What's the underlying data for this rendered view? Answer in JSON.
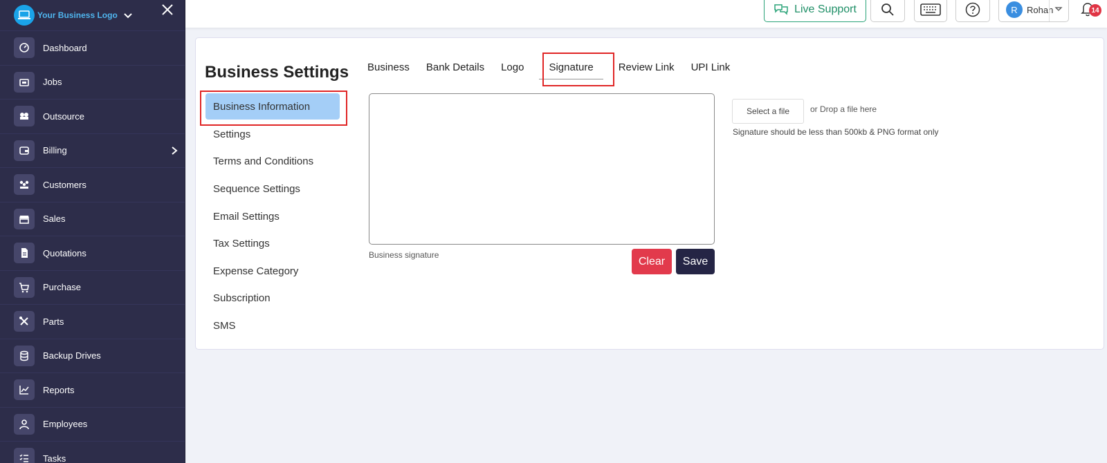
{
  "brand": {
    "name": "Your Business Logo"
  },
  "sidebar": {
    "items": [
      {
        "label": "Dashboard",
        "icon": "dashboard-icon"
      },
      {
        "label": "Jobs",
        "icon": "jobs-icon"
      },
      {
        "label": "Outsource",
        "icon": "outsource-icon"
      },
      {
        "label": "Billing",
        "icon": "wallet-icon"
      },
      {
        "label": "Customers",
        "icon": "users-icon"
      },
      {
        "label": "Sales",
        "icon": "store-icon"
      },
      {
        "label": "Quotations",
        "icon": "document-icon"
      },
      {
        "label": "Purchase",
        "icon": "cart-icon"
      },
      {
        "label": "Parts",
        "icon": "tools-icon"
      },
      {
        "label": "Backup Drives",
        "icon": "database-icon"
      },
      {
        "label": "Reports",
        "icon": "chart-icon"
      },
      {
        "label": "Employees",
        "icon": "employee-icon"
      },
      {
        "label": "Tasks",
        "icon": "tasks-icon"
      }
    ]
  },
  "topbar": {
    "live_support": "Live Support",
    "user_initial": "R",
    "user_name": "Rohan",
    "notification_count": "14"
  },
  "page": {
    "title": "Business Settings",
    "subnav": [
      "Business Information",
      "Settings",
      "Terms and Conditions",
      "Sequence Settings",
      "Email Settings",
      "Tax Settings",
      "Expense Category",
      "Subscription",
      "SMS"
    ],
    "tabs": [
      "Business",
      "Bank Details",
      "Logo",
      "Signature",
      "Review Link",
      "UPI Link"
    ],
    "active_tab": "Signature",
    "signature": {
      "label": "Business signature",
      "clear": "Clear",
      "save": "Save",
      "select_file": "Select a file",
      "drop_text": "or Drop a file here",
      "hint": "Signature should be less than 500kb & PNG format only"
    }
  },
  "colors": {
    "sidebar_bg": "#2d2d4a",
    "accent_blue": "#1aa3e8",
    "active_subnav": "#a4cef7",
    "clear_button": "#e23a4c",
    "save_button": "#252545",
    "highlight_outline": "#e02525",
    "live_support_green": "#2aa378"
  }
}
